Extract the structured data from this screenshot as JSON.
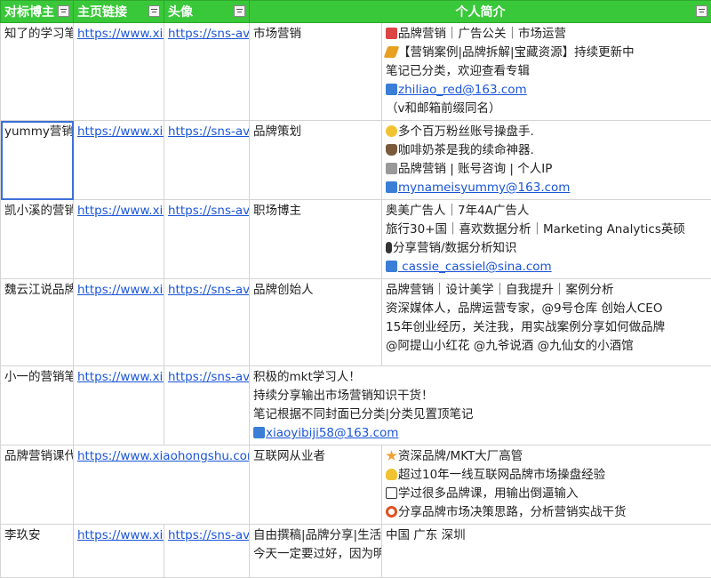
{
  "headers": [
    "对标博主",
    "主页链接",
    "头像",
    "",
    "个人简介"
  ],
  "rows": [
    {
      "name": "知了的学习笔",
      "link": "https://www.xiaohongshu.com",
      "avatar": "https://sns-avatar",
      "field": "市场营销",
      "bio": [
        {
          "icon": "book-icon",
          "text": "品牌营销｜广告公关｜市场运营"
        },
        {
          "icon": "pencil-icon",
          "text": "【营销案例|品牌拆解|宝藏资源】持续更新中"
        },
        {
          "icon": "",
          "text": "笔记已分类，欢迎查看专辑"
        },
        {
          "icon": "mailbox-icon",
          "text": "zhiliao_red@163.com",
          "mail": true
        },
        {
          "icon": "",
          "text": "（v和邮箱前缀同名）"
        }
      ]
    },
    {
      "name": "yummy营销笔",
      "link": "https://www.xiaohongshu.com",
      "avatar": "https://sns-avatar",
      "field": "品牌策划",
      "bio": [
        {
          "icon": "face-icon",
          "text": "多个百万粉丝账号操盘手."
        },
        {
          "icon": "coffee-icon",
          "text": "咖啡奶茶是我的续命神器."
        },
        {
          "icon": "speaker-icon",
          "text": "品牌营销 | 账号咨询 | 个人IP"
        },
        {
          "icon": "mailbox-icon",
          "text": "mynameisyummy@163.com",
          "mail": true
        }
      ]
    },
    {
      "name": "凯小溪的营销",
      "link": "https://www.xiaohongshu.com",
      "avatar": "https://sns-avatar",
      "field": "职场博主",
      "bio": [
        {
          "icon": "",
          "text": "奥美广告人｜7年4A广告人"
        },
        {
          "icon": "",
          "text": "旅行30+国｜喜欢数据分析｜Marketing Analytics英硕"
        },
        {
          "icon": "pill-icon",
          "text": "分享营销/数据分析知识"
        },
        {
          "icon": "mailbox-icon",
          "text": " cassie_cassiel@sina.com",
          "mail": true
        }
      ]
    },
    {
      "name": "魏云江说品牌",
      "link": "https://www.xiaohongshu.com",
      "avatar": "https://sns-avatar",
      "field": "品牌创始人",
      "bio": [
        {
          "icon": "",
          "text": "品牌营销｜设计美学｜自我提升｜案例分析"
        },
        {
          "icon": "",
          "text": " "
        },
        {
          "icon": "",
          "text": "资深媒体人，品牌运营专家，@9号仓库 创始人CEO"
        },
        {
          "icon": "",
          "text": "15年创业经历，关注我，用实战案例分享如何做品牌"
        },
        {
          "icon": "",
          "text": "@阿提山小红花 @九爷说酒 @九仙女的小酒馆"
        }
      ]
    },
    {
      "name": "小一的营销笔",
      "link": "https://www.xiaohongshu.com",
      "avatar": "https://sns-avatar",
      "field_span": [
        {
          "icon": "",
          "text": "积极的mkt学习人！"
        },
        {
          "icon": "",
          "text": "持续分享输出市场营销知识干货！"
        },
        {
          "icon": "",
          "text": "笔记根据不同封面已分类|分类见置顶笔记"
        },
        {
          "icon": "mailbox-icon",
          "text": "xiaoyibiji58@163.com",
          "mail": true
        }
      ]
    },
    {
      "name": "品牌营销课代",
      "link": "https://www.xiaohongshu.com/user",
      "field": "互联网从业者",
      "bio": [
        {
          "icon": "star-icon",
          "text": "资深品牌/MKT大厂高管"
        },
        {
          "icon": "bulb-icon",
          "text": "超过10年一线互联网品牌市场操盘经验"
        },
        {
          "icon": "frame-icon",
          "text": "学过很多品牌课，用输出倒逼输入"
        },
        {
          "icon": "ring-icon",
          "text": "分享品牌市场决策思路，分析营销实战干货"
        }
      ]
    },
    {
      "name": "李玖安",
      "link": "https://www.xiaohongshu.com",
      "avatar": "https://sns-avatar",
      "field": "自由撰稿|品牌分享|生活",
      "field2": "今天一定要过好，因为明",
      "bio": [
        {
          "icon": "",
          "text": "中国 广东 深圳"
        }
      ]
    }
  ]
}
